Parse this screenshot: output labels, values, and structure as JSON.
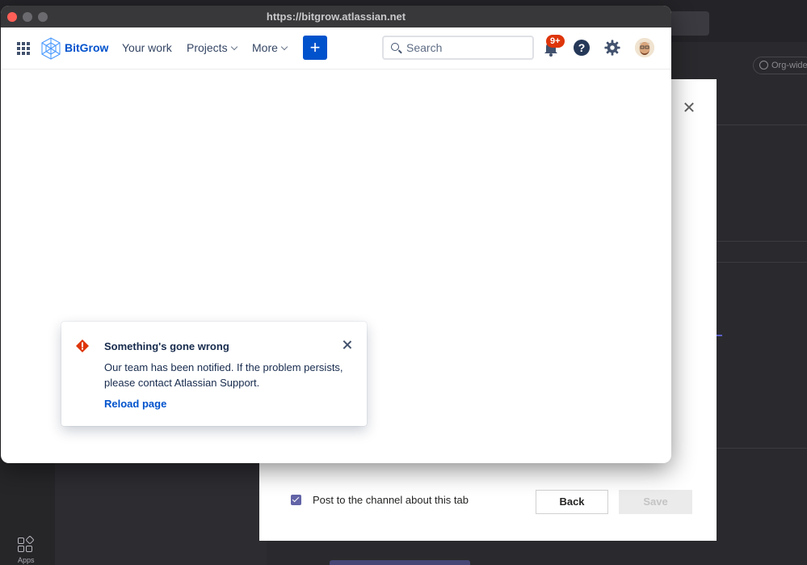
{
  "browser": {
    "url": "https://bitgrow.atlassian.net"
  },
  "navbar": {
    "logo_text": "BitGrow",
    "items": [
      {
        "label": "Your work"
      },
      {
        "label": "Projects"
      },
      {
        "label": "More"
      }
    ],
    "create_label": "+",
    "search_placeholder": "Search",
    "notification_badge": "9+",
    "help_label": "?"
  },
  "error_flag": {
    "title": "Something's gone wrong",
    "message": "Our team has been notified. If the problem persists, please contact Atlassian Support.",
    "action": "Reload page"
  },
  "teams_dialog": {
    "checkbox_label": "Post to the channel about this tab",
    "checkbox_checked": true,
    "back_label": "Back",
    "save_label": "Save"
  },
  "background": {
    "org_wide_label": "Org-wide",
    "apps_label": "Apps"
  },
  "colors": {
    "accent": "#0052cc",
    "error": "#de350b",
    "teams_accent": "#6264a7"
  }
}
